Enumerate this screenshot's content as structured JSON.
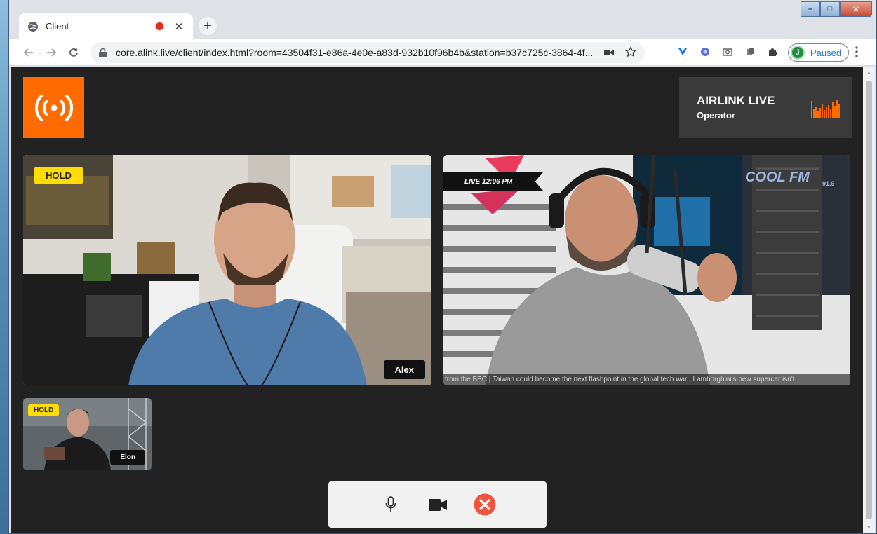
{
  "browser": {
    "tab": {
      "title": "Client",
      "close_glyph": "✕"
    },
    "new_tab_glyph": "+",
    "url": "core.alink.live/client/index.html?room=43504f31-e86a-4e0e-a83d-932b10f96b4b&station=b37c725c-3864-4f...",
    "profile": {
      "initial": "J",
      "label": "Paused"
    },
    "window_controls": {
      "minimize": "–",
      "maximize": "□",
      "close": "✕"
    },
    "icons": [
      "globe-icon",
      "recording-icon",
      "back-icon",
      "forward-icon",
      "reload-icon",
      "lock-icon",
      "camera-icon",
      "star-icon",
      "extension-icons",
      "puzzle-icon",
      "kebab-icon"
    ]
  },
  "app": {
    "brand": {
      "name": "AIRLINK LIVE",
      "role": "Operator"
    },
    "colors": {
      "accent": "#ff6b00",
      "hold": "#ffdd00",
      "page_bg": "#222222",
      "end_call": "#f0543c"
    },
    "tiles": [
      {
        "name": "Alex",
        "badge": "HOLD"
      },
      {
        "overlay": "LIVE 12:06 PM",
        "ticker": "from the BBC | Taiwan could become the next flashpoint in the global tech war | Lamborghini's new supercar isn't",
        "logo_text": "COOL FM",
        "logo_freq": "91.9"
      },
      {
        "name": "Elon",
        "badge": "HOLD"
      }
    ],
    "controls": {
      "mic": "microphone-icon",
      "camera": "video-camera-icon",
      "hangup": "end-call-icon"
    }
  }
}
